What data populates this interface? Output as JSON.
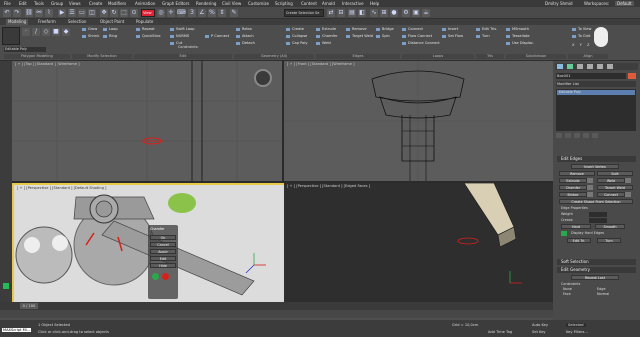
{
  "menu": {
    "items": [
      "File",
      "Edit",
      "Tools",
      "Group",
      "Views",
      "Create",
      "Modifiers",
      "Animation",
      "Graph Editors",
      "Rendering",
      "Civil View",
      "Customize",
      "Scripting",
      "Content",
      "Arnold",
      "Interactive",
      "Help"
    ],
    "user": "Dmitry Shmid",
    "workspaces_label": "Workspaces:",
    "workspace_value": "Default"
  },
  "toolbar": {
    "view_dropdown": "View",
    "selection_set": "Create Selection Se"
  },
  "ribbon": {
    "tabs": [
      "Modeling",
      "Freeform",
      "Selection",
      "Object Paint",
      "Populate"
    ],
    "active_tab": "Modeling",
    "modify_mode_label": "Editable Poly",
    "groups": [
      "Polygon Modeling",
      "Modify Selection",
      "Edit",
      "Geometry (All)",
      "Edges",
      "Loops",
      "Tris",
      "Subdivision",
      "Align"
    ],
    "buttons": {
      "grow": "Grow",
      "shrink": "Shrink",
      "loop": "Loop",
      "ring": "Ring",
      "repeat": "Repeat",
      "quickslice": "QuickSlice",
      "swiftloop": "Swift Loop",
      "nurms": "NURMS",
      "cut": "Cut",
      "p_connect": "P Connect",
      "constraints": "Constraints:",
      "relax": "Relax",
      "attach": "Attach",
      "detach": "Detach",
      "create": "Create",
      "collapse": "Collapse",
      "cap_poly": "Cap Poly",
      "chamfer": "Chamfer",
      "weld": "Weld",
      "extrude": "Extrude",
      "remove": "Remove",
      "target_weld": "Target Weld",
      "bridge": "Bridge",
      "spin": "Spin",
      "connect": "Connect",
      "flow_connect": "Flow Connect",
      "distance_connect": "Distance Connect",
      "insert": "Insert",
      "set_flow": "Set Flow",
      "tris_edit": "Edit Tris.",
      "turn": "Turn",
      "msmooth": "MSmooth",
      "tessellate": "Tessellate",
      "use_displace": "Use Displac.",
      "to_view": "To View",
      "to_grid": "To Grid",
      "x_label": "X",
      "y_label": "Y",
      "z_label": "Z"
    }
  },
  "viewports": {
    "top": "[ + ] [Top ] [Standard ] [Wireframe ]",
    "front": "[ + ] [Front ] [Standard ] [Wireframe ]",
    "persp": "[ + ] [Perspective ] [Standard ] [Default Shading ]",
    "perspective": "[ + ] [Perspective ] [Standard ] [Edged Faces ]"
  },
  "quad_menu": {
    "items": [
      "Chamfer",
      "Ok",
      "Cancel",
      "Apply",
      "Edit",
      "Hide"
    ]
  },
  "command_panel": {
    "object_name": "Box001",
    "modifier_list": "Modifier List",
    "stack_item": "Editable Poly",
    "rollouts": {
      "edit_edges": "Edit Edges",
      "soft_selection": "Soft Selection",
      "edit_geometry": "Edit Geometry"
    },
    "edit_edges": {
      "insert_vertex": "Insert Vertex",
      "remove": "Remove",
      "split": "Split",
      "extrude": "Extrude",
      "weld": "Weld",
      "chamfer": "Chamfer",
      "target_weld": "Target Weld",
      "bridge": "Bridge",
      "connect": "Connect",
      "create_shape": "Create Shape From Selection",
      "edge_properties": "Edge Properties",
      "weight": "Weight",
      "crease": "Crease",
      "hard": "Hard",
      "smooth": "Smooth",
      "display_hard": "Display Hard Edges",
      "edit_tri": "Edit Tri.",
      "turn": "Turn"
    },
    "edit_geometry": {
      "repeat_last": "Repeat Last",
      "constraints_label": "Constraints",
      "none": "None",
      "edge": "Edge",
      "face": "Face",
      "normal": "Normal"
    }
  },
  "timeline": {
    "frame": "0 / 100"
  },
  "status": {
    "maxscript": "MAXScript Mi...",
    "selected": "1 Object Selected",
    "hint": "Click or click-and-drag to select objects",
    "grid": "Grid = 10,0cm",
    "add_time_tag": "Add Time Tag",
    "selected_dropdown": "Selected",
    "set_key": "Set Key",
    "auto_key": "Auto Key",
    "key_filters": "Key Filters..."
  },
  "colors": {
    "accent": "#e4e4e4",
    "selected_tab": "#e05a3c",
    "highlight_green": "#2aa84a",
    "axis_red": "#d8201a",
    "viewport_bg": "#5c5c5c",
    "persp_bg": "#dcdcdc"
  }
}
